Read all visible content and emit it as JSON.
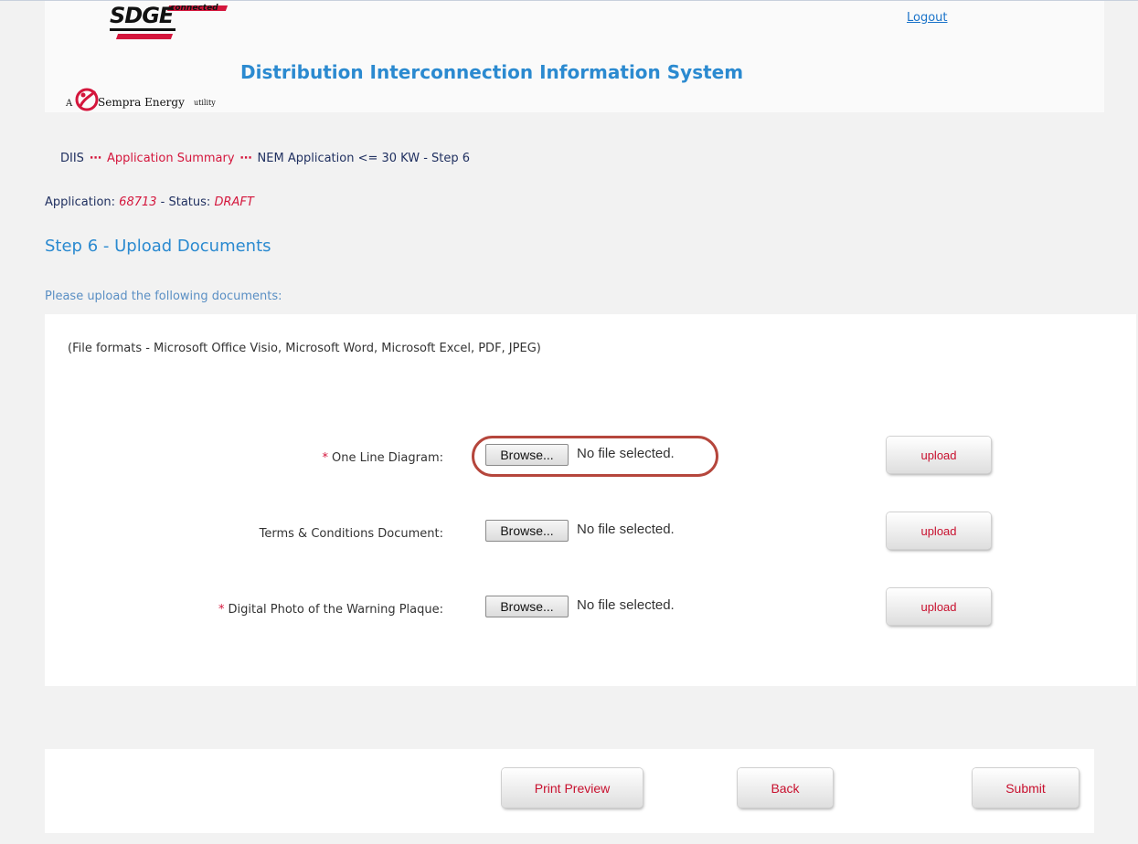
{
  "header": {
    "logo": {
      "brand": "SDGE",
      "tagline": "connected",
      "parent_prefix": "A",
      "parent": "Sempra Energy",
      "parent_suffix": "utility"
    },
    "system_title": "Distribution Interconnection Information System",
    "logout_label": "Logout"
  },
  "breadcrumb": {
    "home": "DIIS",
    "link": "Application Summary",
    "current": "NEM Application <= 30 KW - Step 6"
  },
  "application": {
    "label": "Application:",
    "number": "68713",
    "separator": "- Status:",
    "status": "DRAFT"
  },
  "step_title": "Step 6 - Upload Documents",
  "instructions": "Please upload the following documents:",
  "formats_note": "(File formats - Microsoft Office Visio, Microsoft Word, Microsoft Excel, PDF, JPEG)",
  "required_marker": "*",
  "documents": [
    {
      "label": "One Line Diagram:",
      "required": true,
      "browse_label": "Browse...",
      "file_status": "No file selected.",
      "upload_label": "upload"
    },
    {
      "label": "Terms & Conditions Document:",
      "required": false,
      "browse_label": "Browse...",
      "file_status": "No file selected.",
      "upload_label": "upload"
    },
    {
      "label": "Digital Photo of the Warning Plaque:",
      "required": true,
      "browse_label": "Browse...",
      "file_status": "No file selected.",
      "upload_label": "upload"
    }
  ],
  "actions": {
    "print_preview": "Print Preview",
    "back": "Back",
    "submit": "Submit"
  },
  "colors": {
    "accent_blue": "#2b8ad0",
    "brand_red": "#d4163c",
    "highlight": "#b5463c"
  }
}
